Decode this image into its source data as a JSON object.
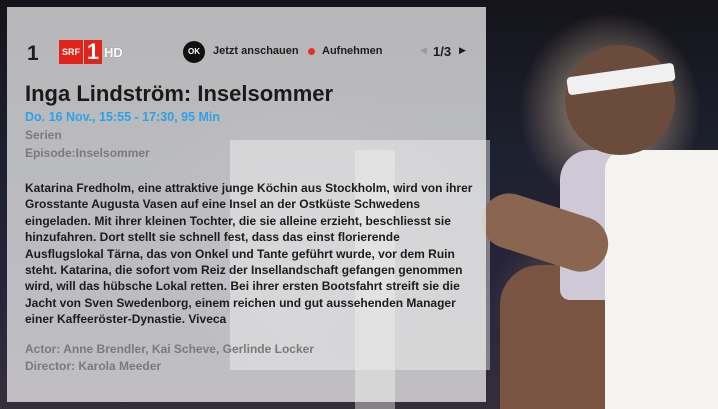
{
  "channel": {
    "number": "1",
    "logo_srf": "SRF",
    "logo_one": "1",
    "logo_hd": "HD"
  },
  "actions": {
    "ok_key": "OK",
    "watch_now": "Jetzt anschauen",
    "record": "Aufnehmen",
    "record_color": "#e53024"
  },
  "pager": {
    "label": "1/3"
  },
  "program": {
    "title": "Inga Lindström: Inselsommer",
    "time": "Do. 16 Nov., 15:55 - 17:30, 95 Min",
    "genre": "Serien",
    "episode": "Episode:Inselsommer",
    "description": "Katarina Fredholm, eine attraktive junge Köchin aus Stockholm, wird von ihrer Grosstante Augusta Vasen auf eine Insel an der Ostküste Schwedens eingeladen. Mit ihrer kleinen Tochter, die sie alleine erzieht, beschliesst sie hinzufahren. Dort stellt sie schnell fest, dass das einst florierende Ausflugslokal Tärna, das von Onkel und Tante geführt wurde, vor dem Ruin steht. Katarina, die sofort vom Reiz der Insellandschaft gefangen genommen wird, will das hübsche Lokal retten. Bei ihrer ersten Bootsfahrt streift sie die Jacht von Sven Swedenborg, einem reichen und gut aussehenden Manager einer Kaffeeröster-Dynastie. Viveca",
    "actors": "Actor: Anne Brendler, Kai Scheve, Gerlinde Locker",
    "director": "Director: Karola Meeder"
  },
  "colors": {
    "accent_time": "#2aa3e6",
    "brand_red": "#e2231a"
  }
}
